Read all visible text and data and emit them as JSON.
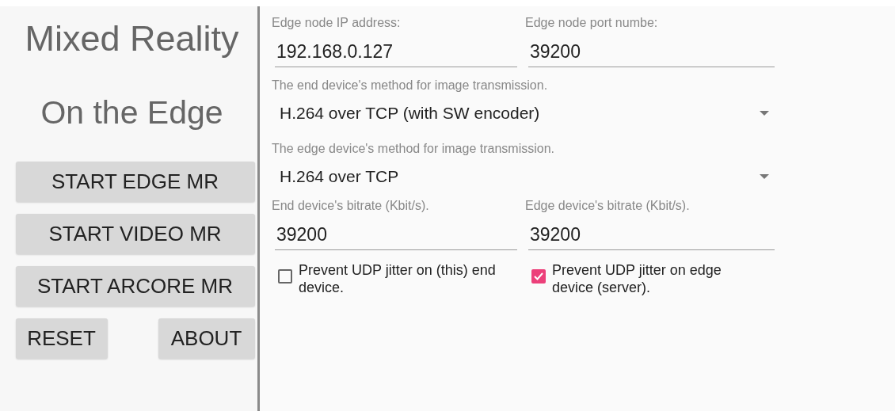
{
  "sidebar": {
    "title": "Mixed Reality",
    "subtitle": "On the Edge",
    "buttons": [
      {
        "label": "START EDGE MR",
        "kind": "wide"
      },
      {
        "label": "START VIDEO MR",
        "kind": "wide"
      },
      {
        "label": "START ARCORE MR",
        "kind": "wide"
      },
      {
        "label": "RESET",
        "kind": "half"
      },
      {
        "label": "ABOUT",
        "kind": "half"
      }
    ]
  },
  "settings": {
    "address_fields": [
      {
        "label": "Edge node IP address:",
        "value": "192.168.0.127"
      },
      {
        "label": "Edge node port numbe:",
        "value": "39200"
      }
    ],
    "dropdowns": [
      {
        "label": "The end device's method for image transmission.",
        "value": "H.264 over TCP (with SW encoder)"
      },
      {
        "label": "The edge device's method for image transmission.",
        "value": "H.264 over TCP"
      }
    ],
    "bitrate_fields": [
      {
        "label": "End device's bitrate (Kbit/s).",
        "value": "39200"
      },
      {
        "label": "Edge device's bitrate (Kbit/s).",
        "value": "39200"
      }
    ],
    "checkboxes": [
      {
        "label": "Prevent UDP jitter on (this) end device.",
        "checked": false
      },
      {
        "label": "Prevent UDP jitter on edge device (server).",
        "checked": true
      }
    ]
  }
}
